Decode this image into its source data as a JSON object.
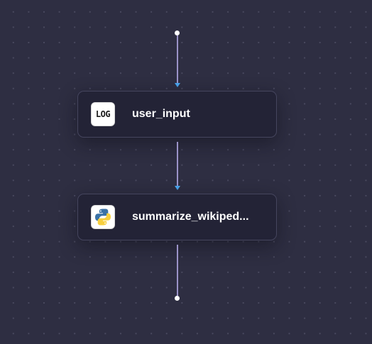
{
  "flow": {
    "nodes": [
      {
        "label": "user_input",
        "icon": "log-icon",
        "icon_text": "LOG"
      },
      {
        "label": "summarize_wikiped...",
        "icon": "python-icon"
      }
    ]
  },
  "colors": {
    "canvas_background": "#2e2e42",
    "grid_dot": "#4a4a60",
    "node_background": "#232336",
    "node_border": "#45455e",
    "edge": "#9b93c9",
    "arrow": "#4aa6f0",
    "python_blue": "#3a72a6",
    "python_yellow": "#f7cf3e"
  }
}
